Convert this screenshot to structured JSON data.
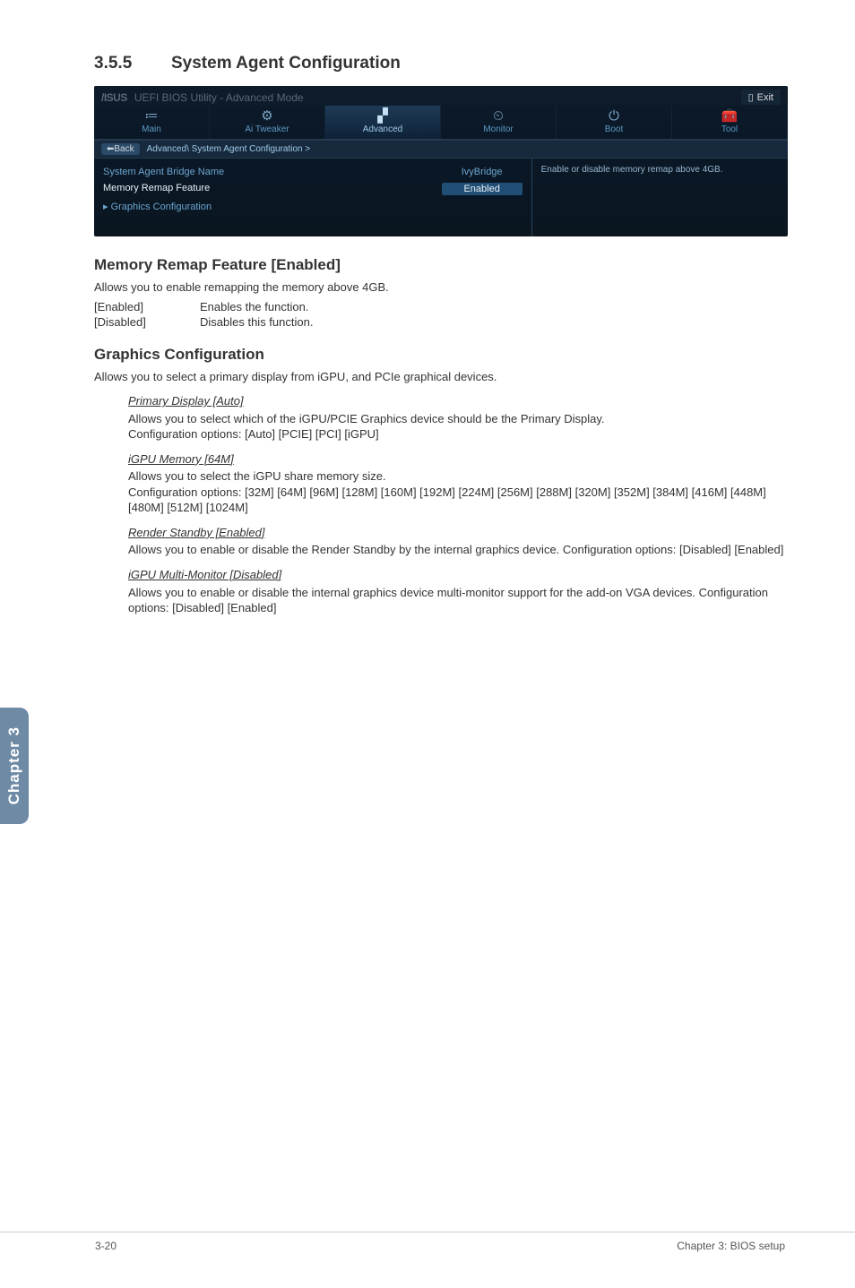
{
  "section": {
    "number": "3.5.5",
    "title": "System Agent Configuration"
  },
  "bios": {
    "logo": "/ISUS",
    "utility_title": "UEFI BIOS Utility - Advanced Mode",
    "exit": "Exit",
    "tabs": [
      {
        "icon": "≔",
        "label": "Main"
      },
      {
        "icon": "⚙",
        "label": "Ai Tweaker"
      },
      {
        "icon": "▞",
        "label": "Advanced",
        "active": true
      },
      {
        "icon": "⏲",
        "label": "Monitor"
      },
      {
        "icon": "⏻",
        "label": "Boot"
      },
      {
        "icon": "🧰",
        "label": "Tool"
      }
    ],
    "breadcrumb_back": "Back",
    "breadcrumb": "Advanced\\ System Agent Configuration >",
    "options": [
      {
        "label": "System Agent Bridge Name",
        "value": "IvyBridge"
      },
      {
        "label": "Memory Remap Feature",
        "value": "Enabled",
        "boxed": true,
        "selected": true
      },
      {
        "label": "Graphics Configuration",
        "value": "",
        "prefix": "▸ "
      }
    ],
    "right_note": "Enable or disable memory remap above 4GB."
  },
  "doc": {
    "mem_head": "Memory Remap Feature [Enabled]",
    "mem_desc": "Allows you to enable remapping the memory above 4GB.",
    "mem_kv": [
      [
        "[Enabled]",
        "Enables the function."
      ],
      [
        "[Disabled]",
        "Disables this function."
      ]
    ],
    "gfx_head": "Graphics Configuration",
    "gfx_desc": "Allows you to select a primary display from iGPU, and PCIe graphical devices.",
    "subs": [
      {
        "title": "Primary Display [Auto]",
        "lines": [
          "Allows you to select which of the iGPU/PCIE Graphics device should be the Primary Display.",
          "Configuration options: [Auto] [PCIE] [PCI] [iGPU]"
        ]
      },
      {
        "title": "iGPU Memory [64M]",
        "lines": [
          "Allows you to select the iGPU share memory size.",
          "Configuration options: [32M] [64M] [96M] [128M] [160M] [192M] [224M] [256M] [288M] [320M] [352M] [384M] [416M] [448M] [480M] [512M] [1024M]"
        ]
      },
      {
        "title": "Render Standby [Enabled]",
        "lines": [
          "Allows you to enable or disable the Render Standby by the internal graphics device. Configuration options: [Disabled] [Enabled]"
        ]
      },
      {
        "title": "iGPU Multi-Monitor [Disabled]",
        "lines": [
          "Allows you to enable or disable the internal graphics device multi-monitor support for the add-on VGA devices. Configuration options: [Disabled] [Enabled]"
        ]
      }
    ]
  },
  "sidetab": "Chapter 3",
  "footer": {
    "left": "3-20",
    "right": "Chapter 3: BIOS setup"
  }
}
